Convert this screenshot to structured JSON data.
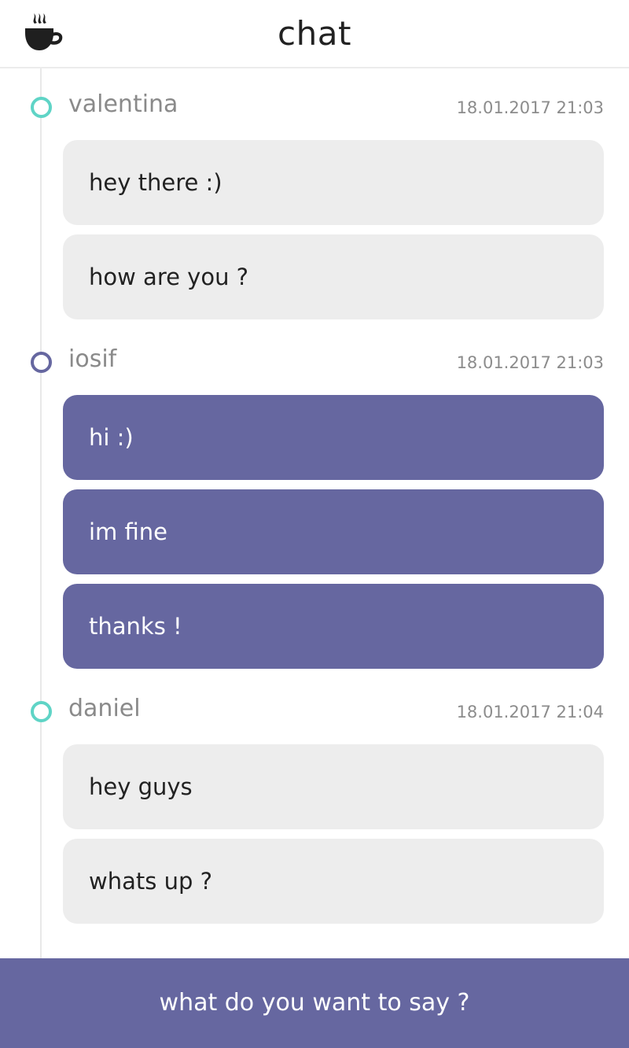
{
  "header": {
    "title": "chat",
    "logo_icon": "coffee-cup-icon"
  },
  "colors": {
    "accent": "#6667a0",
    "other_dot": "#5fd4c6",
    "bubble_other": "#ededed",
    "bubble_mine": "#6667a0"
  },
  "groups": [
    {
      "author": "valentina",
      "time": "18.01.2017 21:03",
      "mine": false,
      "messages": [
        "hey there :)",
        "how are you ?"
      ]
    },
    {
      "author": "iosif",
      "time": "18.01.2017 21:03",
      "mine": true,
      "messages": [
        "hi :)",
        "im fine",
        "thanks !"
      ]
    },
    {
      "author": "daniel",
      "time": "18.01.2017 21:04",
      "mine": false,
      "messages": [
        "hey guys",
        "whats up ?"
      ]
    }
  ],
  "composer": {
    "placeholder": "what do you want to say ?"
  }
}
